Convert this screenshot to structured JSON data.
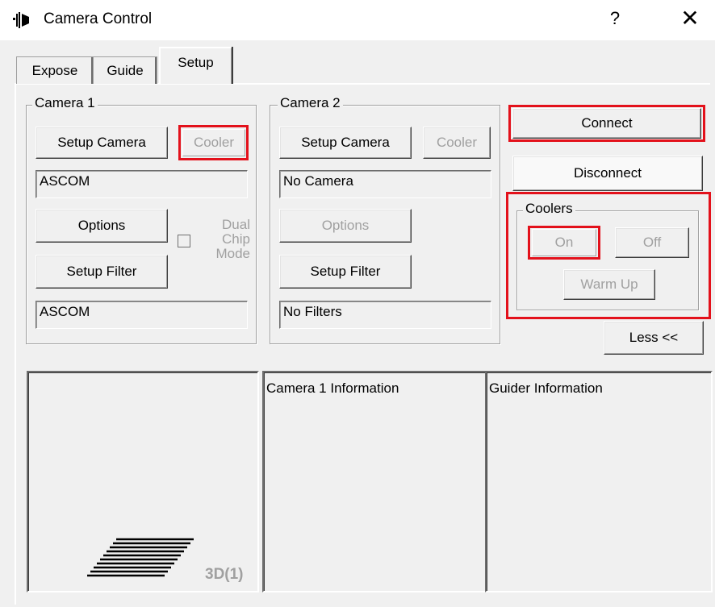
{
  "window": {
    "title": "Camera Control",
    "help_label": "?",
    "close_label": "✕"
  },
  "tabs": [
    {
      "label": "Expose",
      "selected": false
    },
    {
      "label": "Guide",
      "selected": false
    },
    {
      "label": "Setup",
      "selected": true
    }
  ],
  "camera1": {
    "group_label": "Camera 1",
    "setup_camera_label": "Setup Camera",
    "cooler_label": "Cooler",
    "camera_value": "ASCOM",
    "options_label": "Options",
    "dual_chip_label_1": "Dual",
    "dual_chip_label_2": "Chip",
    "dual_chip_label_3": "Mode",
    "setup_filter_label": "Setup Filter",
    "filter_value": "ASCOM"
  },
  "camera2": {
    "group_label": "Camera 2",
    "setup_camera_label": "Setup Camera",
    "cooler_label": "Cooler",
    "camera_value": "No Camera",
    "options_label": "Options",
    "setup_filter_label": "Setup Filter",
    "filter_value": "No Filters"
  },
  "connection": {
    "connect_label": "Connect",
    "disconnect_label": "Disconnect"
  },
  "coolers": {
    "group_label": "Coolers",
    "on_label": "On",
    "off_label": "Off",
    "warm_up_label": "Warm Up"
  },
  "less_label": "Less <<",
  "bottom": {
    "preview_label": "3D(1)",
    "camera1_info_title": "Camera 1 Information",
    "guider_info_title": "Guider Information"
  },
  "colors": {
    "highlight": "#e3111b",
    "window_bg": "#f0f0f0",
    "disabled_text": "#a0a0a0"
  }
}
